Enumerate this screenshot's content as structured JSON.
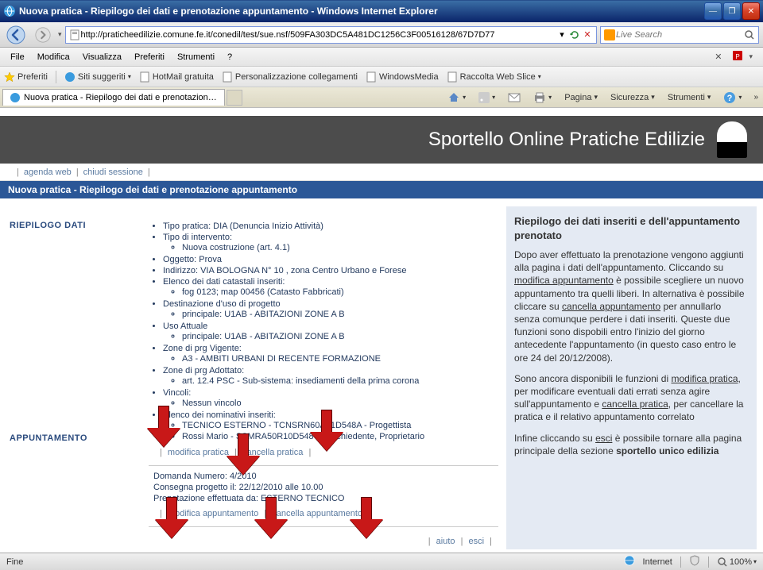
{
  "window": {
    "title": "Nuova pratica - Riepilogo dei dati e prenotazione appuntamento - Windows Internet Explorer"
  },
  "address": "http://praticheedilizie.comune.fe.it/conedil/test/sue.nsf/509FA303DC5A481DC1256C3F00516128/67D7D77",
  "search_placeholder": "Live Search",
  "menu": {
    "file": "File",
    "modifica": "Modifica",
    "visualizza": "Visualizza",
    "preferiti": "Preferiti",
    "strumenti": "Strumenti",
    "help": "?"
  },
  "favorites": {
    "label": "Preferiti",
    "siti": "Siti suggeriti",
    "hotmail": "HotMail gratuita",
    "personalizza": "Personalizzazione collegamenti",
    "windowsmedia": "WindowsMedia",
    "webslice": "Raccolta Web Slice"
  },
  "tab": {
    "label": "Nuova pratica - Riepilogo dei dati e prenotazione app..."
  },
  "cmdbar": {
    "pagina": "Pagina",
    "sicurezza": "Sicurezza",
    "strumenti": "Strumenti"
  },
  "banner": "Sportello Online Pratiche Edilizie",
  "navlinks": {
    "agenda": "agenda web",
    "chiudi": "chiudi sessione"
  },
  "subheader": "Nuova pratica - Riepilogo dei dati e prenotazione appuntamento",
  "labels": {
    "riepilogo": "RIEPILOGO DATI",
    "appuntamento": "APPUNTAMENTO"
  },
  "dati": {
    "tipo_pratica": "Tipo pratica: DIA (Denuncia Inizio Attività)",
    "tipo_intervento": "Tipo di intervento:",
    "intervento_sub": "Nuova costruzione (art. 4.1)",
    "oggetto": "Oggetto: Prova",
    "indirizzo": "Indirizzo: VIA BOLOGNA N° 10 , zona Centro Urbano e Forese",
    "elenco_catastali": "Elenco dei dati catastali inseriti:",
    "catasto_sub": "fog 0123; map 00456 (Catasto Fabbricati)",
    "destinazione": "Destinazione d'uso di progetto",
    "destinazione_sub": "principale: U1AB - ABITAZIONI ZONE A B",
    "uso_attuale": "Uso Attuale",
    "uso_attuale_sub": "principale: U1AB - ABITAZIONI ZONE A B",
    "zone_vigente": "Zone di prg Vigente:",
    "zone_vigente_sub": "A3 - AMBITI URBANI DI RECENTE FORMAZIONE",
    "zone_adottato": "Zone di prg Adottato:",
    "zone_adottato_sub": "art. 12.4 PSC - Sub-sistema: insediamenti della prima corona",
    "vincoli": "Vincoli:",
    "vincoli_sub": "Nessun vincolo",
    "elenco_nominativi": "Elenco dei nominativi inseriti:",
    "nom1": "TECNICO ESTERNO - TCNSRN60A01D548A - Progettista",
    "nom2": "Rossi Mario - SSMRA50R10D548Q - Richiedente, Proprietario"
  },
  "links": {
    "modifica_pratica": "modifica pratica",
    "cancella_pratica": "cancella pratica",
    "modifica_app": "modifica appuntamento",
    "cancella_app": "cancella appuntamento",
    "aiuto": "aiuto",
    "esci": "esci"
  },
  "appuntamento": {
    "l1": "Domanda Numero: 4/2010",
    "l2": "Consegna progetto il: 22/12/2010 alle 10.00",
    "l3": "Prenotazione effettuata da: ESTERNO TECNICO"
  },
  "help": {
    "title": "Riepilogo dei dati inseriti e dell'appuntamento prenotato",
    "p1a": "Dopo aver effettuato la prenotazione vengono aggiunti alla pagina i dati dell'appuntamento. Cliccando su ",
    "p1_link1": "modifica appuntamento",
    "p1b": " è possibile scegliere un nuovo appuntamento tra quelli liberi. In alternativa è possibile cliccare su ",
    "p1_link2": "cancella appuntamento",
    "p1c": " per annullarlo senza comunque perdere i dati inseriti. Queste due funzioni sono dispobili entro l'inizio del giorno antecedente l'appuntamento (in questo caso entro le ore 24 del 20/12/2008).",
    "p2a": "Sono ancora disponibili le funzioni di ",
    "p2_link1": "modifica pratica",
    "p2b": ", per modificare eventuali dati errati senza agire sull'appuntamento e ",
    "p2_link2": "cancella pratica",
    "p2c": ", per cancellare la pratica e il relativo appuntamento correlato",
    "p3a": "Infine cliccando su ",
    "p3_link": "esci",
    "p3b": " è possibile tornare alla pagina principale della sezione ",
    "p3_bold": "sportello unico edilizia"
  },
  "status": {
    "left": "Fine",
    "internet": "Internet",
    "zoom": "100%"
  }
}
